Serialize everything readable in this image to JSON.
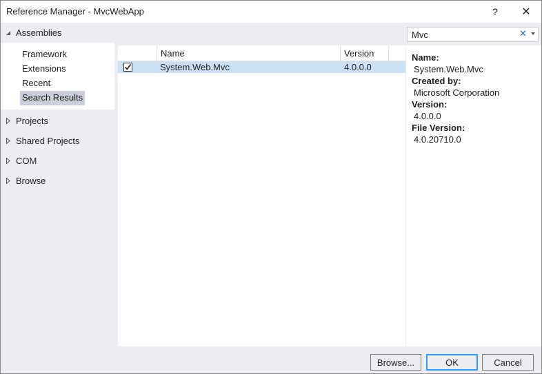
{
  "window": {
    "title": "Reference Manager - MvcWebApp",
    "help_glyph": "?",
    "close_glyph": "✕"
  },
  "sidebar": {
    "groups": [
      {
        "label": "Assemblies",
        "expanded": true
      },
      {
        "label": "Projects",
        "expanded": false
      },
      {
        "label": "Shared Projects",
        "expanded": false
      },
      {
        "label": "COM",
        "expanded": false
      },
      {
        "label": "Browse",
        "expanded": false
      }
    ],
    "assemblies_items": [
      {
        "label": "Framework",
        "selected": false
      },
      {
        "label": "Extensions",
        "selected": false
      },
      {
        "label": "Recent",
        "selected": false
      },
      {
        "label": "Search Results",
        "selected": true
      }
    ]
  },
  "search": {
    "value": "Mvc",
    "clear_glyph": "✕"
  },
  "grid": {
    "columns": [
      "",
      "Name",
      "Version"
    ],
    "rows": [
      {
        "checked": true,
        "name": "System.Web.Mvc",
        "version": "4.0.0.0"
      }
    ]
  },
  "details": {
    "name_label": "Name:",
    "name_value": "System.Web.Mvc",
    "created_by_label": "Created by:",
    "created_by_value": "Microsoft Corporation",
    "version_label": "Version:",
    "version_value": "4.0.0.0",
    "file_version_label": "File Version:",
    "file_version_value": "4.0.20710.0"
  },
  "buttons": {
    "browse": "Browse...",
    "ok": "OK",
    "cancel": "Cancel"
  },
  "colors": {
    "selection_row": "#cce0f5",
    "selected_tree_item": "#cccedb",
    "accent": "#3399ff"
  },
  "icons": {
    "expanded_arrow": "collapse-triangle-icon",
    "collapsed_arrow": "expand-triangle-icon",
    "checkbox": "checkbox-checked-icon",
    "search_clear": "clear-icon",
    "search_dropdown": "chevron-down-icon"
  }
}
